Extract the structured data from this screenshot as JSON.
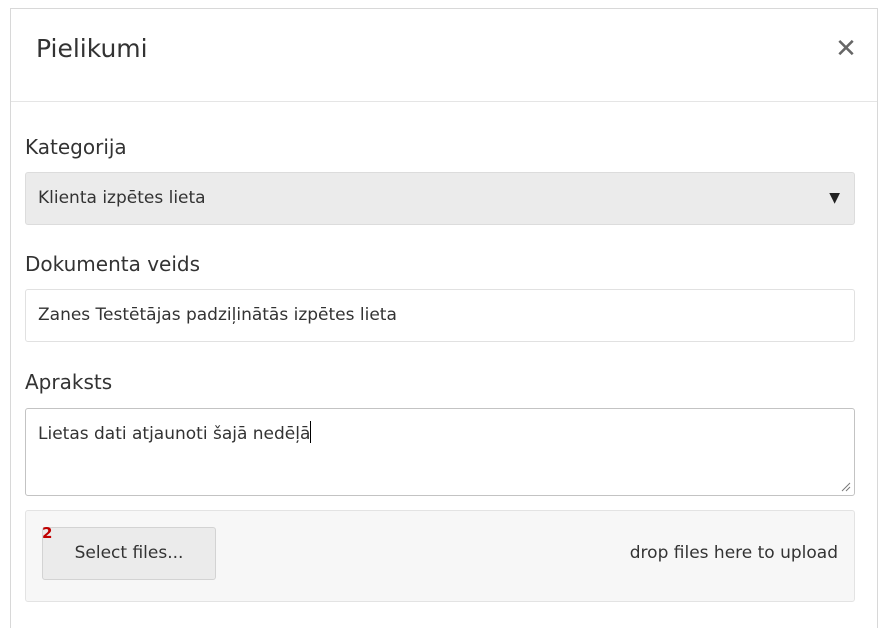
{
  "dialog": {
    "title": "Pielikumi",
    "close_icon": "close-icon"
  },
  "form": {
    "category": {
      "label": "Kategorija",
      "selected": "Klienta izpētes lieta",
      "arrow_icon": "caret-down-icon"
    },
    "document_type": {
      "label": "Dokumenta veids",
      "value": "Zanes Testētājas padziļinātās izpētes lieta"
    },
    "description": {
      "label": "Apraksts",
      "value": "Lietas dati atjaunoti šajā nedēļā"
    },
    "upload": {
      "badge": "2",
      "button_label": "Select files...",
      "drop_hint": "drop files here to upload"
    }
  }
}
